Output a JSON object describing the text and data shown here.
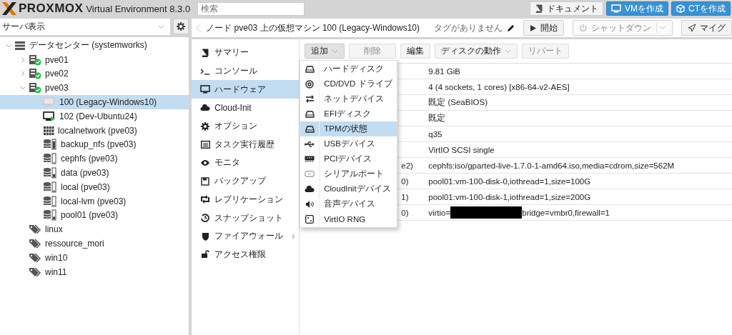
{
  "topbar": {
    "product": "PROXMOX",
    "version": "Virtual Environment 8.3.0",
    "search": {
      "placeholder": "検索"
    },
    "buttons": [
      {
        "label": "ドキュメント",
        "kind": "docs"
      },
      {
        "label": "VMを作成",
        "kind": "vm"
      },
      {
        "label": "CTを作成",
        "kind": "ct"
      }
    ]
  },
  "sidebar": {
    "view_select": "サーバ表示",
    "tree": [
      {
        "kind": "datacenter",
        "label": "データセンター (systemworks)",
        "expanded": true,
        "selected": false,
        "children": [
          {
            "kind": "node",
            "label": "pve01",
            "expanded": false,
            "selected": false
          },
          {
            "kind": "node",
            "label": "pve02",
            "expanded": false,
            "selected": false
          },
          {
            "kind": "node",
            "label": "pve03",
            "expanded": true,
            "selected": false,
            "children": [
              {
                "kind": "vm",
                "label": "100 (Legacy-Windows10)",
                "running": false,
                "selected": true
              },
              {
                "kind": "vm",
                "label": "102 (Dev-Ubuntu24)",
                "running": true,
                "selected": false
              },
              {
                "kind": "network",
                "label": "localnetwork (pve03)",
                "selected": false
              },
              {
                "kind": "storage",
                "label": "backup_nfs (pve03)",
                "level": 0.85,
                "selected": false
              },
              {
                "kind": "storage",
                "label": "cephfs (pve03)",
                "level": 0.05,
                "selected": false
              },
              {
                "kind": "storage",
                "label": "data (pve03)",
                "level": 0.35,
                "selected": false
              },
              {
                "kind": "storage",
                "label": "local (pve03)",
                "level": 0.1,
                "selected": false
              },
              {
                "kind": "storage",
                "label": "local-lvm (pve03)",
                "level": 0.05,
                "selected": false
              },
              {
                "kind": "storage",
                "label": "pool01 (pve03)",
                "level": 0.3,
                "selected": false
              }
            ]
          },
          {
            "kind": "tag",
            "label": "linux",
            "selected": false
          },
          {
            "kind": "tag",
            "label": "ressource_mori",
            "selected": false
          },
          {
            "kind": "tag",
            "label": "win10",
            "selected": false
          },
          {
            "kind": "tag",
            "label": "win11",
            "selected": false
          }
        ]
      }
    ]
  },
  "header": {
    "title": "ノード pve03 上の仮想マシン 100 (Legacy-Windows10)",
    "tags": "タグがありません",
    "buttons": [
      {
        "label": "開始",
        "kind": "start",
        "disabled": false
      },
      {
        "label": "シャットダウン",
        "kind": "shutdown",
        "disabled": true
      },
      {
        "label": "マイグ",
        "kind": "migrate",
        "disabled": false
      }
    ]
  },
  "nav": [
    {
      "kind": "summary",
      "label": "サマリー",
      "selected": false
    },
    {
      "kind": "console",
      "label": "コンソール",
      "selected": false
    },
    {
      "kind": "hardware",
      "label": "ハードウェア",
      "selected": true
    },
    {
      "kind": "cloud",
      "label": "Cloud-Init",
      "selected": false
    },
    {
      "kind": "gear",
      "label": "オプション",
      "selected": false
    },
    {
      "kind": "list",
      "label": "タスク実行履歴",
      "selected": false
    },
    {
      "kind": "eye",
      "label": "モニタ",
      "selected": false
    },
    {
      "kind": "save",
      "label": "バックアップ",
      "selected": false
    },
    {
      "kind": "replicate",
      "label": "レプリケーション",
      "selected": false
    },
    {
      "kind": "history",
      "label": "スナップショット",
      "selected": false
    },
    {
      "kind": "shield",
      "label": "ファイアウォール",
      "selected": false,
      "has_submenu": true
    },
    {
      "kind": "lock",
      "label": "アクセス権限",
      "selected": false
    }
  ],
  "toolbar": [
    {
      "label": "追加",
      "dropdown": true,
      "disabled": false,
      "pressed": true
    },
    {
      "label": "削除",
      "dropdown": false,
      "disabled": true,
      "pressed": false
    },
    {
      "label": "編集",
      "dropdown": false,
      "disabled": false,
      "pressed": false
    },
    {
      "label": "ディスクの動作",
      "dropdown": true,
      "disabled": false,
      "pressed": false
    },
    {
      "label": "リバート",
      "dropdown": false,
      "disabled": true,
      "pressed": false
    }
  ],
  "table": {
    "rows": [
      {
        "value": "9.81 GiB"
      },
      {
        "value": "4 (4 sockets, 1 cores) [x86-64-v2-AES]"
      },
      {
        "value": "既定 (SeaBIOS)"
      },
      {
        "value": "既定"
      },
      {
        "value": "q35"
      },
      {
        "value": "VirtIO SCSI single"
      },
      {
        "key_fragment": "e2)",
        "value": "cephfs:iso/gparted-live-1.7.0-1-amd64.iso,media=cdrom,size=562M"
      },
      {
        "key_fragment": "0)",
        "value": "pool01:vm-100-disk-0,iothread=1,size=100G"
      },
      {
        "key_fragment": "1)",
        "value": "pool01:vm-100-disk-1,iothread=1,size=200G"
      },
      {
        "key_fragment": "0)",
        "value": "virtio=",
        "redacted": true,
        "value_after": "bridge=vmbr0,firewall=1"
      }
    ]
  },
  "add_menu": [
    {
      "kind": "disk",
      "label": "ハードディスク",
      "selected": false
    },
    {
      "kind": "cd",
      "label": "CD/DVD ドライブ",
      "selected": false
    },
    {
      "kind": "net",
      "label": "ネットデバイス",
      "selected": false
    },
    {
      "kind": "disk",
      "label": "EFIディスク",
      "selected": false
    },
    {
      "kind": "disk",
      "label": "TPMの状態",
      "selected": true
    },
    {
      "kind": "usb",
      "label": "USBデバイス",
      "selected": false
    },
    {
      "kind": "pci",
      "label": "PCIデバイス",
      "selected": false
    },
    {
      "kind": "serial",
      "label": "シリアルポート",
      "selected": false
    },
    {
      "kind": "cloud",
      "label": "CloudInitデバイス",
      "selected": false
    },
    {
      "kind": "sound",
      "label": "音声デバイス",
      "selected": false
    },
    {
      "kind": "rng",
      "label": "VirtIO RNG",
      "selected": false
    }
  ]
}
